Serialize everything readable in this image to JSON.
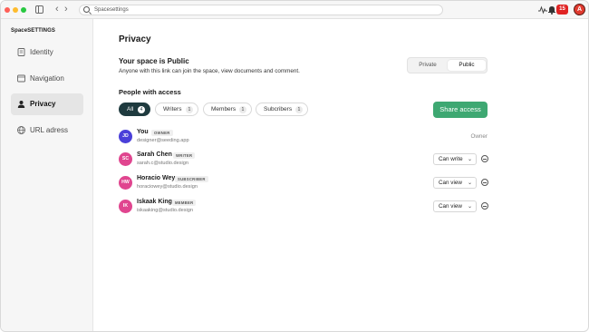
{
  "browser": {
    "address": "Spacesettings",
    "notification_count": "15",
    "brand_letter": "A"
  },
  "sidebar": {
    "title": "SpaceSETTINGS",
    "items": [
      {
        "label": "Identity",
        "icon": "id-card-icon",
        "active": false
      },
      {
        "label": "Navigation",
        "icon": "window-icon",
        "active": false
      },
      {
        "label": "Privacy",
        "icon": "person-icon",
        "active": true
      },
      {
        "label": "URL adress",
        "icon": "globe-icon",
        "active": false
      }
    ]
  },
  "main": {
    "title": "Privacy",
    "visibility": {
      "heading": "Your space is Public",
      "description": "Anyone with this link can join the space, view documents and comment.",
      "options": [
        "Private",
        "Public"
      ],
      "selected": "Public"
    },
    "people": {
      "heading": "People with access",
      "filters": [
        {
          "label": "All",
          "count": "4",
          "active": true
        },
        {
          "label": "Writers",
          "count": "1",
          "active": false
        },
        {
          "label": "Members",
          "count": "1",
          "active": false
        },
        {
          "label": "Subcribers",
          "count": "1",
          "active": false
        }
      ],
      "share_label": "Share access",
      "members": [
        {
          "initials": "JD",
          "name": "You",
          "role": "OWNER",
          "email": "designer@seeding.app",
          "permission": "Owner",
          "avatar_color": "#4a3fd9"
        },
        {
          "initials": "SC",
          "name": "Sarah Chen",
          "role": "WRITER",
          "email": "sarah.c@studio.design",
          "permission": "Can write",
          "avatar_color": "#e0458f"
        },
        {
          "initials": "HW",
          "name": "Horacio Wey",
          "role": "SUBSCRIBER",
          "email": "horaciowey@studio.design",
          "permission": "Can view",
          "avatar_color": "#e0458f"
        },
        {
          "initials": "IK",
          "name": "Iskaak King",
          "role": "MEMBER",
          "email": "iskaaking@studio.design",
          "permission": "Can view",
          "avatar_color": "#e0458f"
        }
      ]
    }
  },
  "colors": {
    "accent_green": "#3ea872",
    "active_filter": "#1f3b3f",
    "badge_red": "#e02424"
  }
}
